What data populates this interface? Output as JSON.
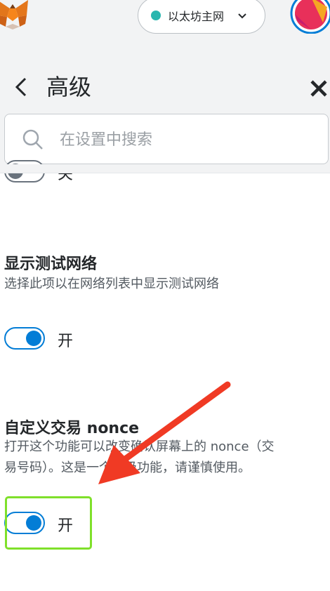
{
  "network": {
    "name": "以太坊主网",
    "dot_color": "#29b6af"
  },
  "page": {
    "title": "高级"
  },
  "search": {
    "placeholder": "在设置中搜索"
  },
  "settings": [
    {
      "id": "previous",
      "title": "",
      "description": "",
      "state": "off",
      "state_label": "关"
    },
    {
      "id": "show-test-networks",
      "title": "显示测试网络",
      "description": "选择此项以在网络列表中显示测试网络",
      "state": "on",
      "state_label": "开"
    },
    {
      "id": "custom-nonce",
      "title": "自定义交易 nonce",
      "description_line1": "打开这个功能可以改变确认屏幕上的 nonce（交",
      "description_line2": "易号码）。这是一个高级功能，请谨慎使用。",
      "state": "on",
      "state_label": "开"
    }
  ],
  "colors": {
    "accent": "#037dd6",
    "highlight_box": "#7fe02a",
    "annotation_arrow": "#f03a24"
  },
  "icons": [
    "metamask-fox-icon",
    "chevron-down-icon",
    "account-avatar",
    "back-arrow-icon",
    "close-icon",
    "search-icon"
  ]
}
